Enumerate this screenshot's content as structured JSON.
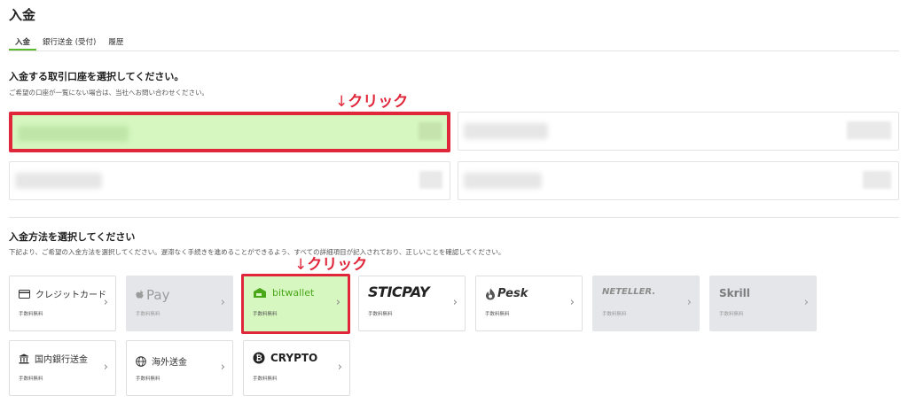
{
  "page": {
    "title": "入金"
  },
  "tabs": [
    {
      "label": "入金",
      "active": true
    },
    {
      "label": "銀行送金 (受付)",
      "active": false
    },
    {
      "label": "履歴",
      "active": false
    }
  ],
  "accounts_section": {
    "title": "入金する取引口座を選択してください。",
    "description": "ご希望の口座が一覧にない場合は、当社へお問い合わせください。",
    "annotation": "クリック",
    "accounts": [
      {
        "state": "selected"
      },
      {
        "state": "default"
      },
      {
        "state": "default"
      },
      {
        "state": "default"
      }
    ]
  },
  "methods_section": {
    "title": "入金方法を選択してください",
    "description": "下記より、ご希望の入金方法を選択してください。遅滞なく手続きを進めることができるよう、すべての詳細項目が記入されており、正しいことを確認してください。",
    "annotation": "クリック",
    "chevron": "›",
    "methods": [
      {
        "label": "クレジットカード",
        "fee": "手数料無料",
        "icon": "credit-card-icon",
        "state": "default"
      },
      {
        "label": "Pay",
        "fee": "手数料無料",
        "icon": "apple-icon",
        "state": "disabled"
      },
      {
        "label": "bitwallet",
        "fee": "手数料無料",
        "icon": "bitwallet-icon",
        "state": "selected"
      },
      {
        "label": "STICPAY",
        "fee": "手数料無料",
        "icon": "",
        "state": "default"
      },
      {
        "label": "Pesk",
        "fee": "手数料無料",
        "icon": "pesk-flame-icon",
        "state": "default"
      },
      {
        "label": "NETELLER.",
        "fee": "手数料無料",
        "icon": "",
        "state": "disabled"
      },
      {
        "label": "Skrill",
        "fee": "手数料無料",
        "icon": "",
        "state": "disabled"
      },
      {
        "label": "国内銀行送金",
        "fee": "手数料無料",
        "icon": "bank-icon",
        "state": "default"
      },
      {
        "label": "海外送金",
        "fee": "手数料無料",
        "icon": "globe-icon",
        "state": "default"
      },
      {
        "label": "CRYPTO",
        "fee": "手数料無料",
        "icon": "bitcoin-icon",
        "state": "default"
      }
    ]
  },
  "colors": {
    "accent_green": "#5cb82e",
    "selected_fill": "#d6f7c0",
    "annotation_red": "#e0263a",
    "disabled_fill": "#e5e6ea"
  }
}
